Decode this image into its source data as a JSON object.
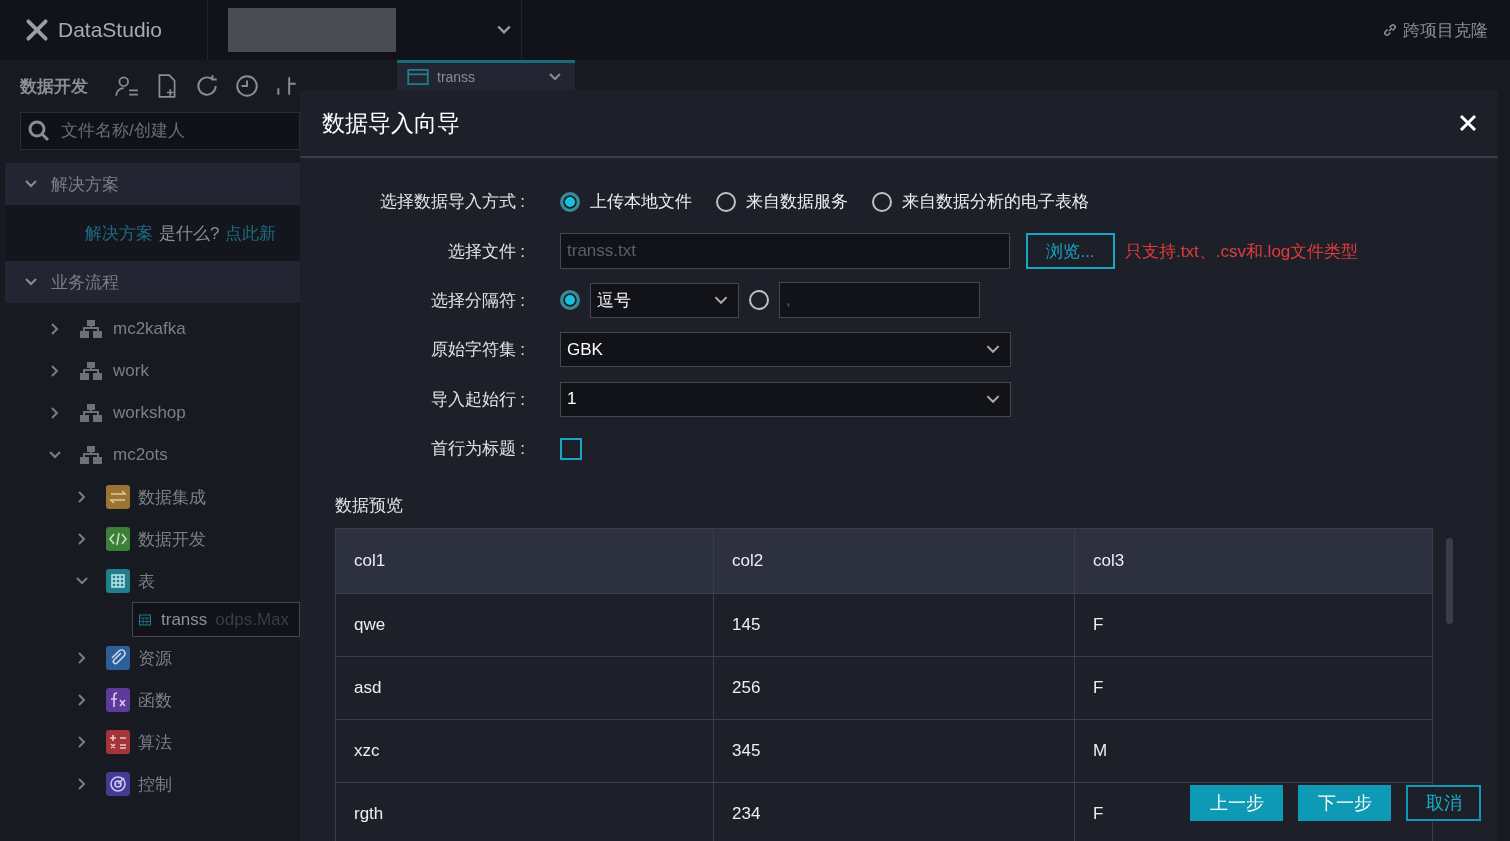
{
  "app": {
    "logo": "DataStudio",
    "clone_link": "跨项目克隆"
  },
  "sidebar": {
    "title": "数据开发",
    "search": {
      "placeholder": "文件名称/创建人"
    },
    "solutions": {
      "label": "解决方案",
      "expanded": true,
      "intro": [
        {
          "text": "解决方案",
          "kind": "link"
        },
        {
          "text": "是什么?",
          "kind": "text"
        },
        {
          "text": "点此新",
          "kind": "link"
        }
      ]
    },
    "flows": {
      "label": "业务流程",
      "expanded": true,
      "items": [
        {
          "label": "mc2kafka",
          "expanded": false
        },
        {
          "label": "work",
          "expanded": false
        },
        {
          "label": "workshop",
          "expanded": false
        },
        {
          "label": "mc2ots",
          "expanded": true,
          "children": [
            {
              "label": "数据集成",
              "kind": "integration",
              "color": "#9a7430",
              "expanded": false
            },
            {
              "label": "数据开发",
              "kind": "development",
              "color": "#3c7f38",
              "expanded": false
            },
            {
              "label": "表",
              "kind": "table",
              "color": "#1f7f8c",
              "expanded": true,
              "children": [
                {
                  "label": "transs",
                  "suffix": "odps.Max",
                  "selected": true
                }
              ]
            },
            {
              "label": "资源",
              "kind": "resource",
              "color": "#2c5f97",
              "expanded": false
            },
            {
              "label": "函数",
              "kind": "function",
              "color": "#5e3a9c",
              "expanded": false
            },
            {
              "label": "算法",
              "kind": "algorithm",
              "color": "#a3353a",
              "expanded": false
            },
            {
              "label": "控制",
              "kind": "control",
              "color": "#433a96",
              "expanded": false
            }
          ]
        }
      ]
    }
  },
  "tabs": [
    {
      "label": "transs",
      "selected": true
    }
  ],
  "dialog": {
    "title": "数据导入向导",
    "method": {
      "label": "选择数据导入方式 :",
      "options": [
        {
          "label": "上传本地文件",
          "selected": true
        },
        {
          "label": "来自数据服务",
          "selected": false
        },
        {
          "label": "来自数据分析的电子表格",
          "selected": false
        }
      ]
    },
    "file": {
      "label": "选择文件 :",
      "placeholder": "transs.txt",
      "browse": "浏览...",
      "hint": "只支持.txt、.csv和.log文件类型"
    },
    "delimiter": {
      "label": "选择分隔符 :",
      "preset": {
        "selected": true,
        "value": "逗号"
      },
      "custom": {
        "selected": false,
        "placeholder": ","
      }
    },
    "charset": {
      "label": "原始字符集 :",
      "value": "GBK"
    },
    "start_row": {
      "label": "导入起始行 :",
      "value": "1"
    },
    "header_row": {
      "label": "首行为标题 :",
      "checked": false
    },
    "preview": {
      "title": "数据预览",
      "columns": [
        "col1",
        "col2",
        "col3"
      ],
      "rows": [
        [
          "qwe",
          "145",
          "F"
        ],
        [
          "asd",
          "256",
          "F"
        ],
        [
          "xzc",
          "345",
          "M"
        ],
        [
          "rgth",
          "234",
          "F"
        ]
      ]
    },
    "buttons": [
      {
        "label": "上一步",
        "kind": "primary"
      },
      {
        "label": "下一步",
        "kind": "primary"
      },
      {
        "label": "取消",
        "kind": "outline"
      }
    ]
  }
}
